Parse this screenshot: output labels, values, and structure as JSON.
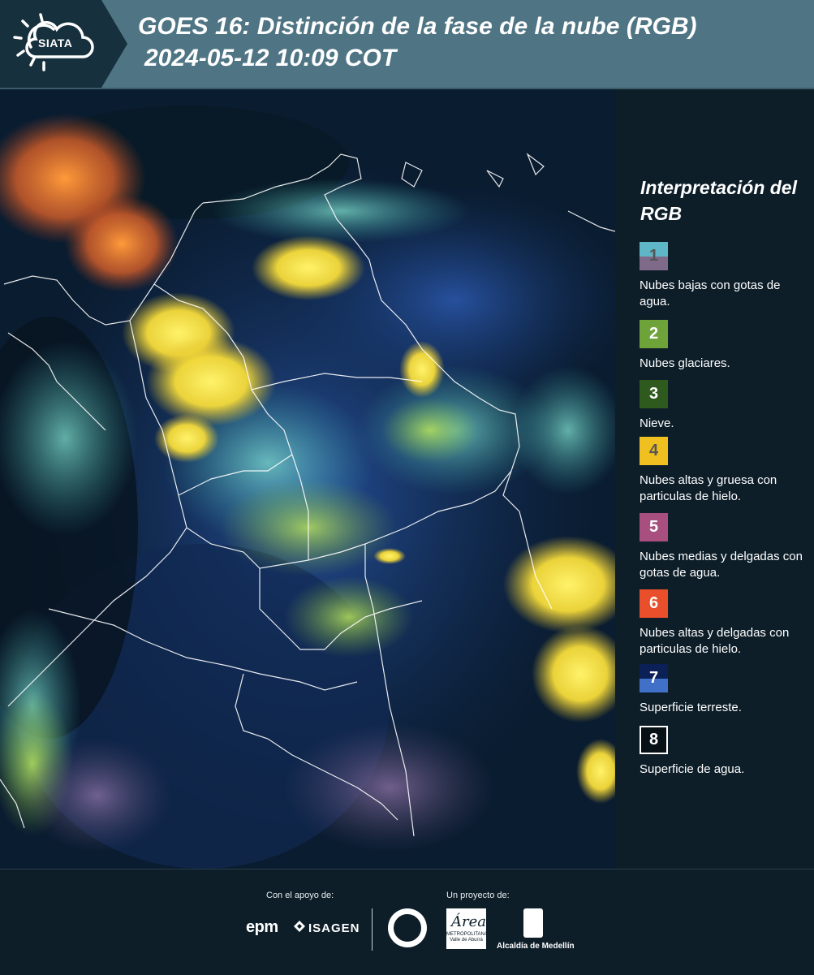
{
  "header": {
    "logo_text": "SIATA",
    "title": "GOES 16: Distinción de la fase de la nube (RGB)",
    "subtitle": "2024-05-12 10:09 COT"
  },
  "legend": {
    "title": "Interpretación del RGB",
    "items": [
      {
        "num": "1",
        "label": "Nubes bajas con gotas de agua.",
        "color_top": "#5fb6c6",
        "color_bottom": "#7f6a8a",
        "num_color": "#555555"
      },
      {
        "num": "2",
        "label": "Nubes glaciares.",
        "color_top": "#6ea33a",
        "color_bottom": "#6ea33a",
        "num_color": "#ffffff"
      },
      {
        "num": "3",
        "label": "Nieve.",
        "color_top": "#2f5a1e",
        "color_bottom": "#2f5a1e",
        "num_color": "#ffffff"
      },
      {
        "num": "4",
        "label": "Nubes altas y gruesa con particulas de hielo.",
        "color_top": "#f0bf20",
        "color_bottom": "#f0bf20",
        "num_color": "#555555"
      },
      {
        "num": "5",
        "label": "Nubes medias y delgadas con gotas de agua.",
        "color_top": "#a84f80",
        "color_bottom": "#a84f80",
        "num_color": "#ffffff"
      },
      {
        "num": "6",
        "label": "Nubes altas y delgadas con particulas de hielo.",
        "color_top": "#e84f2a",
        "color_bottom": "#e84f2a",
        "num_color": "#ffffff"
      },
      {
        "num": "7",
        "label": "Superficie terreste.",
        "color_top": "#0c2058",
        "color_bottom": "#4070c8",
        "num_color": "#ffffff"
      },
      {
        "num": "8",
        "label": "Superficie de agua.",
        "color_top": "#071015",
        "color_bottom": "#071015",
        "num_color": "#ffffff"
      }
    ]
  },
  "footer": {
    "support_caption": "Con el apoyo de:",
    "project_caption": "Un proyecto de:",
    "epm": "epm",
    "isagen": "ISAGEN",
    "area_script": "Área",
    "area_text": "METROPOLITANA Valle de Aburrá",
    "medellin": "Alcaldía de Medellín"
  }
}
